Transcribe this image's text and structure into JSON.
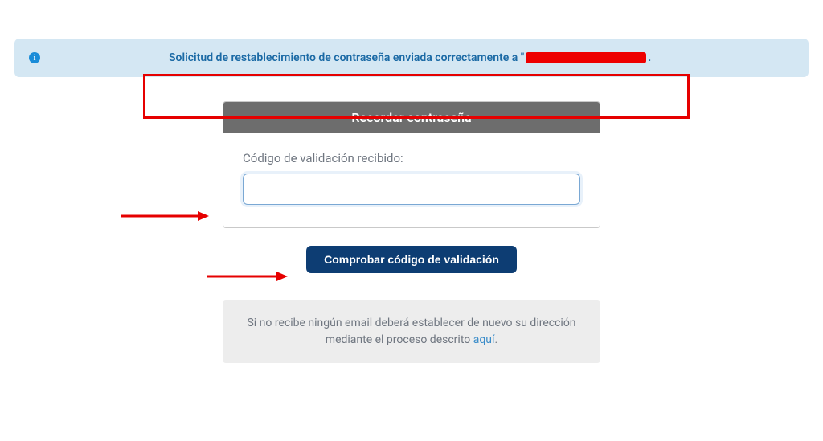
{
  "alert": {
    "message_prefix": "Solicitud de restablecimiento de contraseña enviada correctamente a \"",
    "message_suffix": "."
  },
  "card": {
    "title": "Recordar contraseña",
    "field_label": "Código de validación recibido:",
    "input_value": ""
  },
  "actions": {
    "submit_label": "Comprobar código de validación"
  },
  "hint": {
    "text_before": "Si no recibe ningún email deberá establecer de nuevo su dirección mediante el proceso descrito ",
    "link_text": "aquí",
    "text_after": "."
  }
}
